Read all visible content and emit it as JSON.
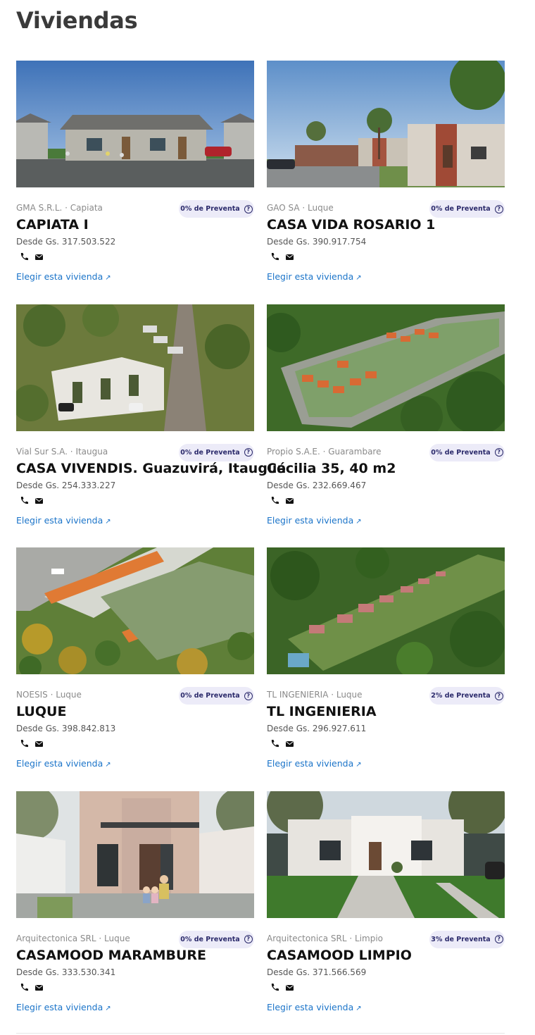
{
  "page": {
    "title": "Viviendas"
  },
  "labels": {
    "choose": "Elegir esta vivienda",
    "arrow": "↗",
    "help": "?"
  },
  "colors": {
    "badge_bg": "#ecebf8",
    "badge_text": "#2b2a6b",
    "link": "#1b74c9"
  },
  "listings": [
    {
      "company": "GMA S.R.L. · Capiata",
      "badge": "0% de Preventa",
      "name": "CAPIATA I",
      "price": "Desde Gs. 317.503.522",
      "image": "row-houses-street"
    },
    {
      "company": "GAO SA · Luque",
      "badge": "0% de Preventa",
      "name": "CASA VIDA ROSARIO 1",
      "price": "Desde Gs. 390.917.754",
      "image": "brick-houses-trees"
    },
    {
      "company": "Vial Sur S.A. · Itaugua",
      "badge": "0% de Preventa",
      "name": "CASA VIVENDIS. Guazuvirá, Itauguá",
      "price": "Desde Gs. 254.333.227",
      "image": "duplex-aerial"
    },
    {
      "company": "Propio S.A.E. · Guarambare",
      "badge": "0% de Preventa",
      "name": "Cecilia 35, 40 m2",
      "price": "Desde Gs. 232.669.467",
      "image": "aerial-forest-lots"
    },
    {
      "company": "NOESIS · Luque",
      "badge": "0% de Preventa",
      "name": "LUQUE",
      "price": "Desde Gs. 398.842.813",
      "image": "aerial-orange-roofs"
    },
    {
      "company": "TL INGENIERIA · Luque",
      "badge": "2% de Preventa",
      "name": "TL INGENIERIA",
      "price": "Desde Gs. 296.927.611",
      "image": "aerial-forest-rows"
    },
    {
      "company": "Arquitectonica SRL · Luque",
      "badge": "0% de Preventa",
      "name": "CASAMOOD MARAMBURE",
      "price": "Desde Gs. 333.530.341",
      "image": "modern-facade-family"
    },
    {
      "company": "Arquitectonica SRL · Limpio",
      "badge": "3% de Preventa",
      "name": "CASAMOOD LIMPIO",
      "price": "Desde Gs. 371.566.569",
      "image": "white-house-lawn"
    }
  ]
}
